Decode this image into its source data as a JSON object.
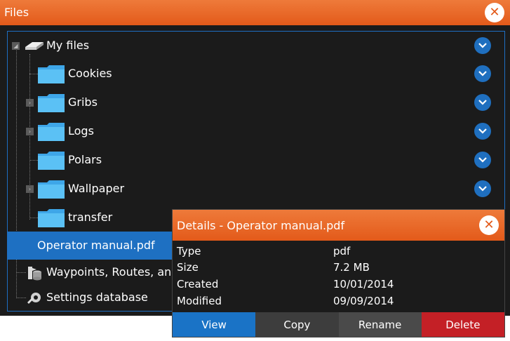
{
  "window": {
    "title": "Files",
    "close_icon": "close-icon"
  },
  "tree": {
    "root": "My files",
    "folders": [
      "Cookies",
      "Gribs",
      "Logs",
      "Polars",
      "Wallpaper",
      "transfer"
    ],
    "files": [
      "Operator manual.pdf"
    ],
    "others": [
      "Waypoints, Routes, and",
      "Settings database"
    ]
  },
  "details": {
    "title": "Details - Operator manual.pdf",
    "rows": [
      {
        "key": "Type",
        "value": "pdf"
      },
      {
        "key": "Size",
        "value": "7.2 MB"
      },
      {
        "key": "Created",
        "value": "10/01/2014"
      },
      {
        "key": "Modified",
        "value": "09/09/2014"
      }
    ],
    "buttons": {
      "view": "View",
      "copy": "Copy",
      "rename": "Rename",
      "delete": "Delete"
    }
  },
  "colors": {
    "accent_orange": "#e35a1a",
    "selected_blue": "#1e70c2",
    "button_blue": "#1a73c6",
    "delete_red": "#c42026"
  }
}
